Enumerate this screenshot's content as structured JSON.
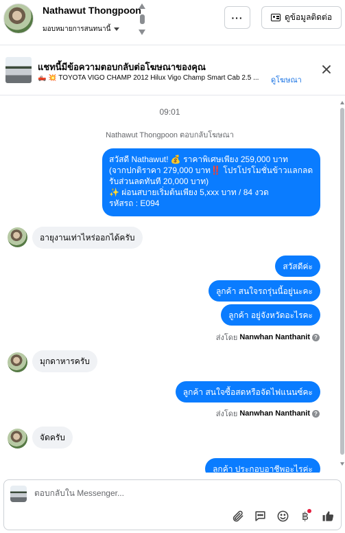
{
  "header": {
    "contact_name": "Nathawut Thongpoon",
    "assign_label": "มอบหมายการสนทนานี้",
    "more_label": "···",
    "contact_info_label": "ดูข้อมูลติดต่อ"
  },
  "ad": {
    "title": "แชทนี้มีข้อความตอบกลับต่อโฆษณาของคุณ",
    "description": "🛻 💥 TOYOTA VIGO CHAMP 2012 Hilux Vigo Champ Smart Cab 2.5 ...",
    "link_label": "ดูโฆษณา"
  },
  "thread": {
    "time": "09:01",
    "reply_note": "Nathawut Thongpoon ตอบกลับโฆษณา",
    "messages": [
      {
        "direction": "outgoing",
        "text": "สวัสดี Nathawut! 💰 ราคาพิเศษเพียง 259,000 บาท\n(จากปกติราคา 279,000 บาท‼️ โปรโปรโมชั่นข้าวแลกลด\nรับส่วนลดทันที 20,000 บาท)\n✨ ผ่อนสบายเริ่มต้นเพียง 5,xxx บาท / 84 งวด\n รหัสรถ : E094"
      },
      {
        "direction": "incoming",
        "text": "อายุงานเท่าไหร่ออกได้ครับ"
      },
      {
        "direction": "outgoing",
        "text": "สวัสดีค่ะ"
      },
      {
        "direction": "outgoing",
        "text": "ลูกค้า สนใจรถรุ่นนี้อยู่นะคะ"
      },
      {
        "direction": "outgoing",
        "text": "ลูกค้า อยู่จังหวัดอะไรคะ"
      },
      {
        "direction": "incoming",
        "text": "มุกดาหารครับ"
      },
      {
        "direction": "outgoing",
        "text": "ลูกค้า สนใจซื้อสดหรือจัดไฟแนนซ์คะ"
      },
      {
        "direction": "incoming",
        "text": "จัดครับ"
      },
      {
        "direction": "outgoing",
        "text": "ลูกค้า ประกอบอาชีพอะไรค่ะ"
      }
    ],
    "sent_by_prefix": "ส่งโดย",
    "sent_by_name": "Nanwhan Nanthanit",
    "help_icon": "?"
  },
  "composer": {
    "placeholder": "ตอบกลับใน Messenger...",
    "currency_symbol": "฿"
  },
  "icons": [
    "chevron-up-icon",
    "chevron-down-icon",
    "contact-card-icon",
    "close-icon",
    "paperclip-icon",
    "chat-bubble-icon",
    "emoji-icon",
    "baht-icon",
    "thumbs-up-icon",
    "help-icon"
  ],
  "colors": {
    "accent": "#0a7cff",
    "incoming_bubble": "#f0f2f5",
    "link": "#1b74e4",
    "badge": "#e41e3f"
  }
}
